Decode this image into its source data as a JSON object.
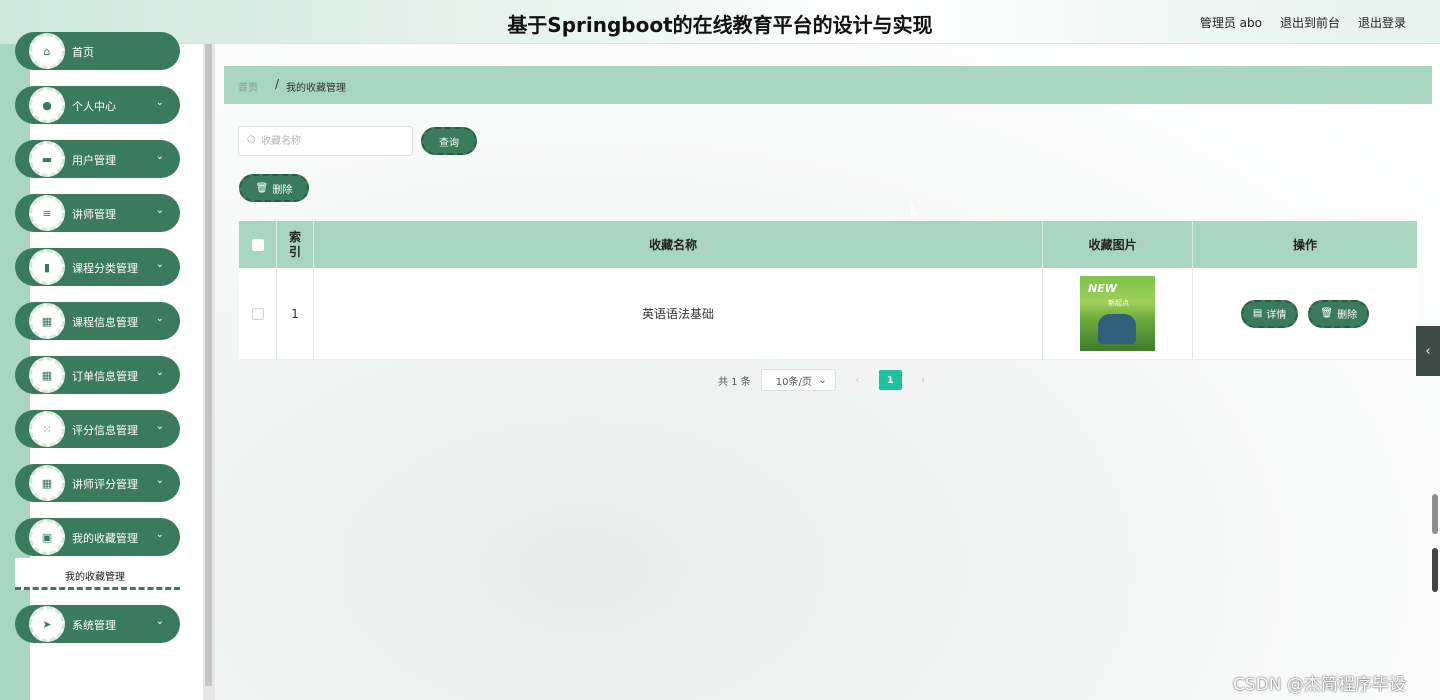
{
  "header": {
    "title": "基于Springboot的在线教育平台的设计与实现",
    "user": "管理员 abo",
    "to_front": "退出到前台",
    "logout": "退出登录"
  },
  "sidebar": {
    "items": [
      {
        "label": "首页",
        "icon": "home-icon"
      },
      {
        "label": "个人中心",
        "icon": "user-icon"
      },
      {
        "label": "用户管理",
        "icon": "briefcase-icon"
      },
      {
        "label": "讲师管理",
        "icon": "list-icon"
      },
      {
        "label": "课程分类管理",
        "icon": "bar-chart-icon"
      },
      {
        "label": "课程信息管理",
        "icon": "grid-icon"
      },
      {
        "label": "订单信息管理",
        "icon": "grid-icon"
      },
      {
        "label": "评分信息管理",
        "icon": "dots-grid-icon"
      },
      {
        "label": "讲师评分管理",
        "icon": "grid-icon"
      },
      {
        "label": "我的收藏管理",
        "icon": "clipboard-icon"
      },
      {
        "label": "系统管理",
        "icon": "send-icon"
      }
    ],
    "submenu_label": "我的收藏管理"
  },
  "breadcrumb": {
    "home": "首页",
    "sep": "/",
    "current": "我的收藏管理"
  },
  "search": {
    "placeholder": "收藏名称",
    "value": "",
    "button": "查询"
  },
  "toolbar": {
    "delete_label": "删除"
  },
  "table": {
    "headers": {
      "index": "索引",
      "name": "收藏名称",
      "image": "收藏图片",
      "ops": "操作"
    },
    "rows": [
      {
        "index": "1",
        "name": "英语语法基础",
        "image_text": "NEW",
        "image_sub": "新起点"
      }
    ],
    "detail_label": "详情",
    "delete_label": "删除"
  },
  "pagination": {
    "total": "共 1 条",
    "page_size": "10条/页",
    "current": "1"
  },
  "watermark": "CSDN @杰简程序毕设",
  "colors": {
    "primary": "#3a7a5d",
    "mint": "#a9d6c2",
    "page_active": "#1dc3a1"
  }
}
